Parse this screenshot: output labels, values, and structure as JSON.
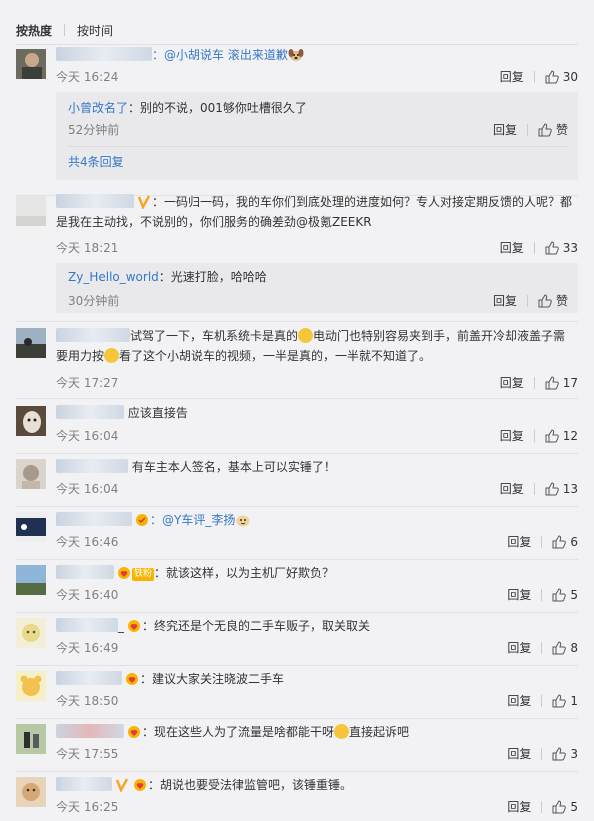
{
  "sort": {
    "hot": "按热度",
    "time": "按时间"
  },
  "ui": {
    "reply": "回复",
    "like": "赞"
  },
  "comments": [
    {
      "text": "：@小胡说车 滚出来道歉",
      "time": "今天 16:24",
      "likes": "30",
      "replies": [
        {
          "user": "小曾改名了",
          "text": "：别的不说，001够你吐槽很久了",
          "time": "52分钟前",
          "likes": "赞"
        }
      ],
      "more": "共4条回复"
    },
    {
      "text1": "：一码归一码，我的车你们到底处理的进度如何？专人对接定期反馈的人呢？都",
      "text2": "是我在主动找，不说别的，你们服务的确差劲@极氪ZEEKR",
      "time": "今天 18:21",
      "likes": "33",
      "replies": [
        {
          "user": "Zy_Hello_world",
          "text": "：光速打脸，哈哈哈",
          "time": "30分钟前",
          "likes": "赞"
        }
      ]
    },
    {
      "text1": "试驾了一下，车机系统卡是真的",
      "text1b": "电动门也特别容易夹到手，前盖开冷却液盖子需",
      "text2": "要用力按",
      "text2b": "看了这个小胡说车的视频，一半是真的，一半就不知道了。",
      "time": "今天 17:27",
      "likes": "17"
    },
    {
      "text": "应该直接告",
      "time": "今天 16:04",
      "likes": "12"
    },
    {
      "text": "有车主本人签名，基本上可以实锤了！",
      "time": "今天 16:04",
      "likes": "13"
    },
    {
      "text": "：@Y车评_李扬",
      "time": "今天 16:46",
      "likes": "6"
    },
    {
      "badge": "铁粉",
      "text": "：就该这样，以为主机厂好欺负？",
      "time": "今天 16:40",
      "likes": "5"
    },
    {
      "text": "：终究还是个无良的二手车贩子，取关取关",
      "time": "今天 16:49",
      "likes": "8"
    },
    {
      "text": "：建议大家关注晓波二手车",
      "time": "今天 18:50",
      "likes": "1"
    },
    {
      "text": "：现在这些人为了流量是啥都能干呀",
      "textb": "直接起诉吧",
      "time": "今天 17:55",
      "likes": "3"
    },
    {
      "text": "：胡说也要受法律监管吧，该锤重锤。",
      "time": "今天 16:25",
      "likes": "5"
    }
  ]
}
